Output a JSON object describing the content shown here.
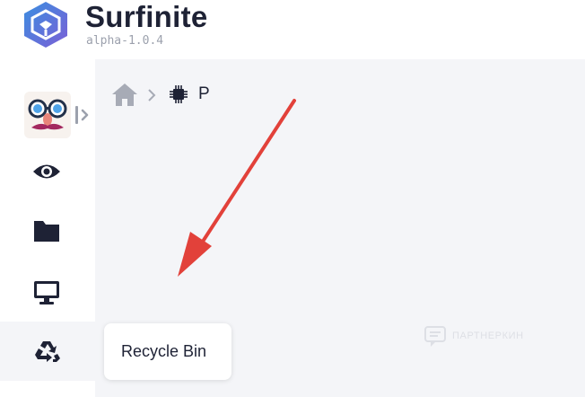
{
  "app": {
    "title": "Surfinite",
    "version": "alpha-1.0.4"
  },
  "colors": {
    "brand_purple": "#7b5fd6",
    "brand_blue": "#3b8ee0",
    "text_dark": "#1e2235",
    "icon_dark": "#1e2235",
    "muted_gray": "#9ca1ad",
    "main_bg": "#f4f5f8",
    "annotation_red": "#e2413a"
  },
  "sidebar": {
    "items": [
      {
        "id": "profile",
        "icon": "disguise-avatar-icon"
      },
      {
        "id": "view",
        "icon": "eye-icon"
      },
      {
        "id": "folder",
        "icon": "folder-icon"
      },
      {
        "id": "desktop",
        "icon": "monitor-icon"
      },
      {
        "id": "recycle",
        "icon": "recycle-icon",
        "active": true
      }
    ],
    "toggle_icon": "sidebar-expand-icon"
  },
  "breadcrumb": {
    "home_icon": "home-icon",
    "separator_icon": "chevron-right-icon",
    "item_icon": "chip-icon",
    "item_label": "P"
  },
  "tooltip": {
    "text": "Recycle Bin"
  },
  "watermark": {
    "icon": "chat-bubble-icon",
    "text": "ПАРТНЕРКИН"
  },
  "annotation": {
    "icon": "red-arrow"
  }
}
